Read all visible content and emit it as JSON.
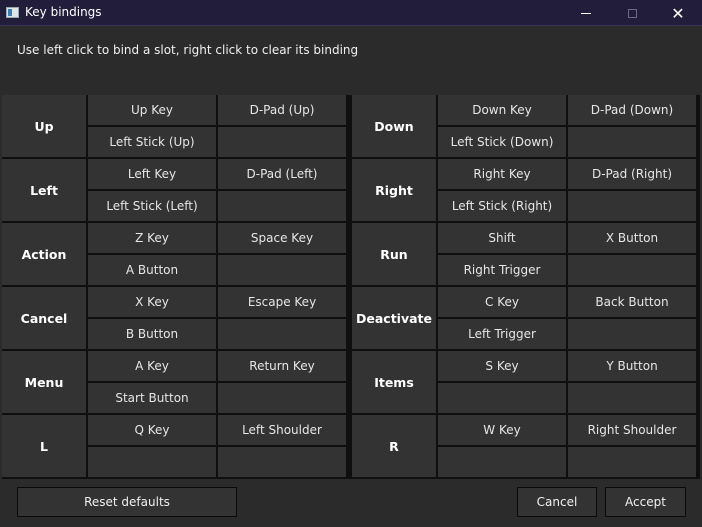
{
  "window": {
    "title": "Key bindings"
  },
  "instructions": "Use left click to bind a slot, right click to clear its binding",
  "bindings": [
    {
      "name": "Up",
      "slots": [
        "Up Key",
        "D-Pad (Up)",
        "Left Stick (Up)",
        ""
      ]
    },
    {
      "name": "Down",
      "slots": [
        "Down Key",
        "D-Pad (Down)",
        "Left Stick (Down)",
        ""
      ]
    },
    {
      "name": "Left",
      "slots": [
        "Left Key",
        "D-Pad (Left)",
        "Left Stick (Left)",
        ""
      ]
    },
    {
      "name": "Right",
      "slots": [
        "Right Key",
        "D-Pad (Right)",
        "Left Stick (Right)",
        ""
      ]
    },
    {
      "name": "Action",
      "slots": [
        "Z Key",
        "Space Key",
        "A Button",
        ""
      ]
    },
    {
      "name": "Run",
      "slots": [
        "Shift",
        "X Button",
        "Right Trigger",
        ""
      ]
    },
    {
      "name": "Cancel",
      "slots": [
        "X Key",
        "Escape Key",
        "B Button",
        ""
      ]
    },
    {
      "name": "Deactivate",
      "slots": [
        "C Key",
        "Back Button",
        "Left Trigger",
        ""
      ]
    },
    {
      "name": "Menu",
      "slots": [
        "A Key",
        "Return Key",
        "Start Button",
        ""
      ]
    },
    {
      "name": "Items",
      "slots": [
        "S Key",
        "Y Button",
        "",
        ""
      ]
    },
    {
      "name": "L",
      "slots": [
        "Q Key",
        "Left Shoulder",
        "",
        ""
      ]
    },
    {
      "name": "R",
      "slots": [
        "W Key",
        "Right Shoulder",
        "",
        ""
      ]
    }
  ],
  "buttons": {
    "reset": "Reset defaults",
    "cancel": "Cancel",
    "accept": "Accept"
  }
}
